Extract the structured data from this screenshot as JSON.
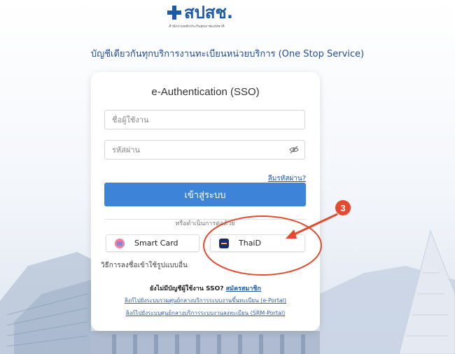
{
  "logo": {
    "name": "สปสช.",
    "subtitle": "สำนักงานหลักประกันสุขภาพแห่งชาติ"
  },
  "header": {
    "service_title": "บัญชีเดียวกันทุกบริการงานทะเบียนหน่วยบริการ (One Stop Service)"
  },
  "login": {
    "title": "e-Authentication (SSO)",
    "username_placeholder": "ชื่อผู้ใช้งาน",
    "password_placeholder": "รหัสผ่าน",
    "forgot_label": "ลืมรหัสผ่าน?",
    "login_label": "เข้าสู่ระบบ",
    "divider_text": "หรือดำเนินการต่อด้วย",
    "smartcard_label": "Smart Card",
    "thaid_label": "ThaiD",
    "other_methods": "วิธีการลงชื่อเข้าใช้รูปแบบอื่น",
    "no_account": "ยังไม่มีบัญชีผู้ใช้งาน SSO?",
    "register_label": "สมัครสมาชิก",
    "eportal_link": "ลิงก์ไปยังระบบรวมศูนย์กลางบริการระบบงานขึ้นทะเบียน (e-Portal)",
    "srmportal_link": "ลิงก์ไปยังระบบศูนย์กลางบริการระบบงานลงทะเบียน (SRM-Portal)"
  },
  "annotation": {
    "step_number": "3",
    "color": "#e64a2e"
  }
}
